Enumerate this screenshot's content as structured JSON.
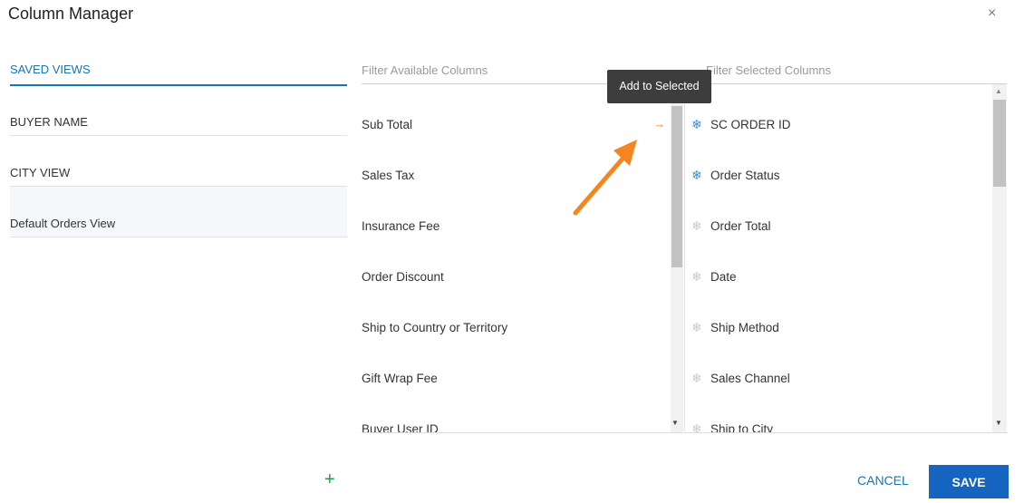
{
  "dialog": {
    "title": "Column Manager",
    "close_glyph": "×"
  },
  "saved_views": {
    "tab_label": "SAVED VIEWS",
    "items": [
      {
        "label": "BUYER NAME"
      },
      {
        "label": "CITY VIEW"
      },
      {
        "label": "Default Orders View"
      }
    ],
    "add_glyph": "+"
  },
  "available": {
    "filter_placeholder": "Filter Available Columns",
    "items": [
      {
        "label": "Sub Total"
      },
      {
        "label": "Sales Tax"
      },
      {
        "label": "Insurance Fee"
      },
      {
        "label": "Order Discount"
      },
      {
        "label": "Ship to Country or Territory"
      },
      {
        "label": "Gift Wrap Fee"
      },
      {
        "label": "Buyer User ID"
      }
    ],
    "add_arrow": "→"
  },
  "selected": {
    "filter_placeholder": "Filter Selected Columns",
    "items": [
      {
        "label": "SC ORDER ID",
        "frozen": true
      },
      {
        "label": "Order Status",
        "frozen": true
      },
      {
        "label": "Order Total",
        "frozen": false
      },
      {
        "label": "Date",
        "frozen": false
      },
      {
        "label": "Ship Method",
        "frozen": false
      },
      {
        "label": "Sales Channel",
        "frozen": false
      },
      {
        "label": "Ship to City",
        "frozen": false
      }
    ]
  },
  "tooltip": {
    "text": "Add to Selected"
  },
  "footer": {
    "cancel_label": "CANCEL",
    "save_label": "SAVE"
  },
  "colors": {
    "accent": "#1a73b4",
    "save_bg": "#1565c0",
    "arrow": "#f5851f",
    "frozen_icon": "#3a8fd0",
    "unfrozen_icon": "#c9c9c9",
    "add_view": "#1e9e4f",
    "annotation_arrow": "#f5851f"
  },
  "icons": {
    "freeze": "snowflake-icon",
    "add_column": "arrow-right-icon",
    "close": "close-icon",
    "add_view": "plus-icon"
  }
}
